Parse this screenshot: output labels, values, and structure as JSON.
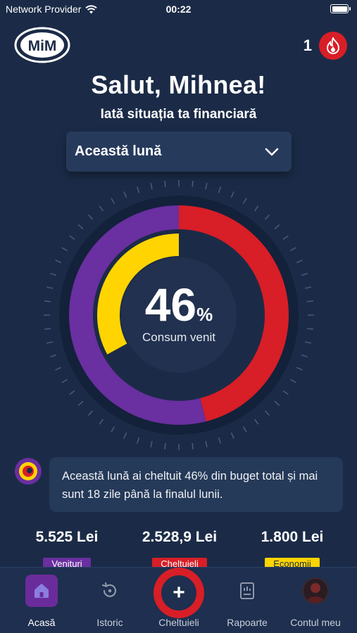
{
  "status_bar": {
    "carrier": "Network Provider",
    "time": "00:22"
  },
  "header": {
    "logo_text": "MiM",
    "streak_count": "1",
    "streak_icon": "flame-icon"
  },
  "greeting": "Salut, Mihnea!",
  "subtitle": "Iată situația ta financiară",
  "period": {
    "selected": "Această lună"
  },
  "gauge": {
    "percent": 46,
    "value_label": "46",
    "unit": "%",
    "label": "Consum venit",
    "outer_ring": {
      "purple_fraction": 0.54,
      "red_fraction": 0.46
    },
    "inner_ring": {
      "yellow_fraction": 0.33
    },
    "colors": {
      "income": "#6a2fa0",
      "expenses": "#d81e27",
      "savings": "#ffd400",
      "track": "#14223a"
    }
  },
  "message": {
    "text": "Această lună ai cheltuit 46% din buget total și mai sunt 18 zile până la finalul lunii."
  },
  "stats": [
    {
      "value": "5.525 Lei",
      "tag": "Venituri",
      "color": "#6a2fa0"
    },
    {
      "value": "2.528,9 Lei",
      "tag": "Cheltuieli",
      "color": "#d81e27"
    },
    {
      "value": "1.800 Lei",
      "tag": "Economii",
      "color": "#ffd400"
    }
  ],
  "nav": {
    "home": "Acasă",
    "history": "Istoric",
    "expenses": "Cheltuieli",
    "reports": "Rapoarte",
    "account": "Contul meu"
  }
}
